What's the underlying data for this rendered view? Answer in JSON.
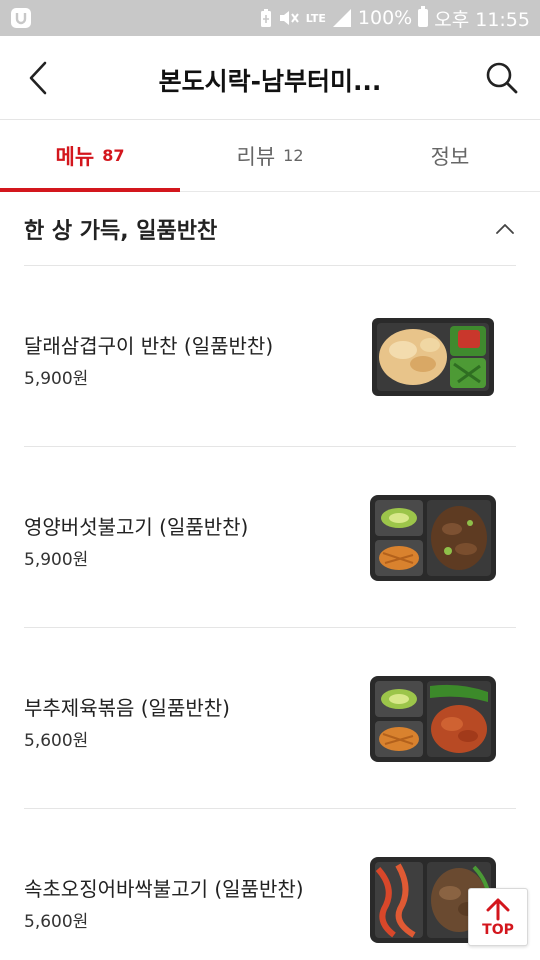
{
  "status_bar": {
    "network_label": "LTE",
    "battery_percent": "100%",
    "time": "오후 11:55",
    "left_icon": "app-notification-icon",
    "icons": [
      "battery-saver-icon",
      "mute-icon",
      "lte-icon",
      "signal-icon",
      "battery-icon"
    ]
  },
  "header": {
    "title": "본도시락-남부터미...",
    "back_icon": "back-arrow-icon",
    "search_icon": "search-icon"
  },
  "tabs": [
    {
      "label": "메뉴",
      "count": "87",
      "active": true
    },
    {
      "label": "리뷰",
      "count": "12",
      "active": false
    },
    {
      "label": "정보",
      "count": "",
      "active": false
    }
  ],
  "category": {
    "title": "한 상 가득, 일품반찬",
    "icon": "chevron-up-icon"
  },
  "menu_items": [
    {
      "name": "달래삼겹구이 반찬 (일품반찬)",
      "price": "5,900원"
    },
    {
      "name": "영양버섯불고기 (일품반찬)",
      "price": "5,900원"
    },
    {
      "name": "부추제육볶음 (일품반찬)",
      "price": "5,600원"
    },
    {
      "name": "속초오징어바싹불고기 (일품반찬)",
      "price": "5,600원"
    }
  ],
  "top_button": {
    "label": "TOP",
    "icon": "arrow-up-icon"
  },
  "colors": {
    "accent": "#d3161d",
    "status_bar": "#c8c8c8",
    "divider": "#e5e5e5"
  }
}
